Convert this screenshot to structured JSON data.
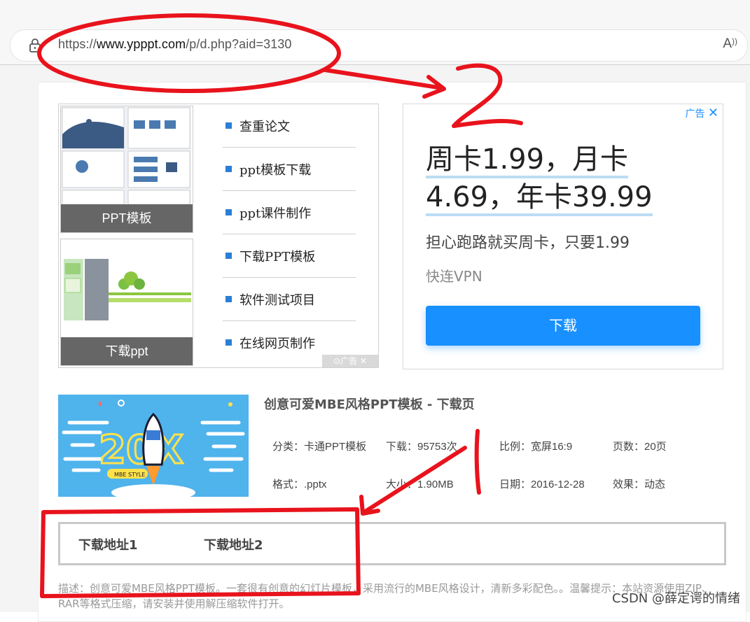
{
  "browser": {
    "url_prefix": "https://",
    "url_domain": "www.ypppt.com",
    "url_path": "/p/d.php?aid=3130",
    "read_aloud_icon": "read-aloud-icon",
    "lock_icon": "lock-icon"
  },
  "left_ad": {
    "thumb1_caption": "PPT模板",
    "thumb2_caption": "下载ppt",
    "links": [
      "查重论文",
      "ppt模板下载",
      "ppt课件制作",
      "下载PPT模板",
      "软件测试项目",
      "在线网页制作"
    ],
    "ad_label": "广告",
    "close_label": "✕"
  },
  "right_ad": {
    "ad_label": "广告",
    "close_label": "✕",
    "headline_line1": "周卡1.99，月卡",
    "headline_line2": "4.69，年卡39.99",
    "subtext": "担心跑路就买周卡，只要1.99",
    "brand": "快连VPN",
    "button_label": "下载"
  },
  "product": {
    "title": "创意可爱MBE风格PPT模板 - 下载页",
    "category": "分类：卡通PPT模板",
    "downloads": "下载：95753次",
    "ratio": "比例：宽屏16:9",
    "pages": "页数：20页",
    "format": "格式：.pptx",
    "size": "大小：1.90MB",
    "date": "日期：2016-12-28",
    "effect": "效果：动态",
    "image_text": "20X",
    "image_badge": "MBE STYLE"
  },
  "download": {
    "tab1": "下载地址1",
    "tab2": "下载地址2"
  },
  "description": "描述：创意可爱MBE风格PPT模板。一套很有创意的幻灯片模板，采用流行的MBE风格设计，清新多彩配色。。温馨提示：本站资源使用ZIP、RAR等格式压缩，请安装并使用解压缩软件打开。",
  "annotations": {
    "number_two": "2",
    "number_one": "1",
    "stroke_color": "#e8131c"
  },
  "watermark": "CSDN @薛定谔的情绪"
}
